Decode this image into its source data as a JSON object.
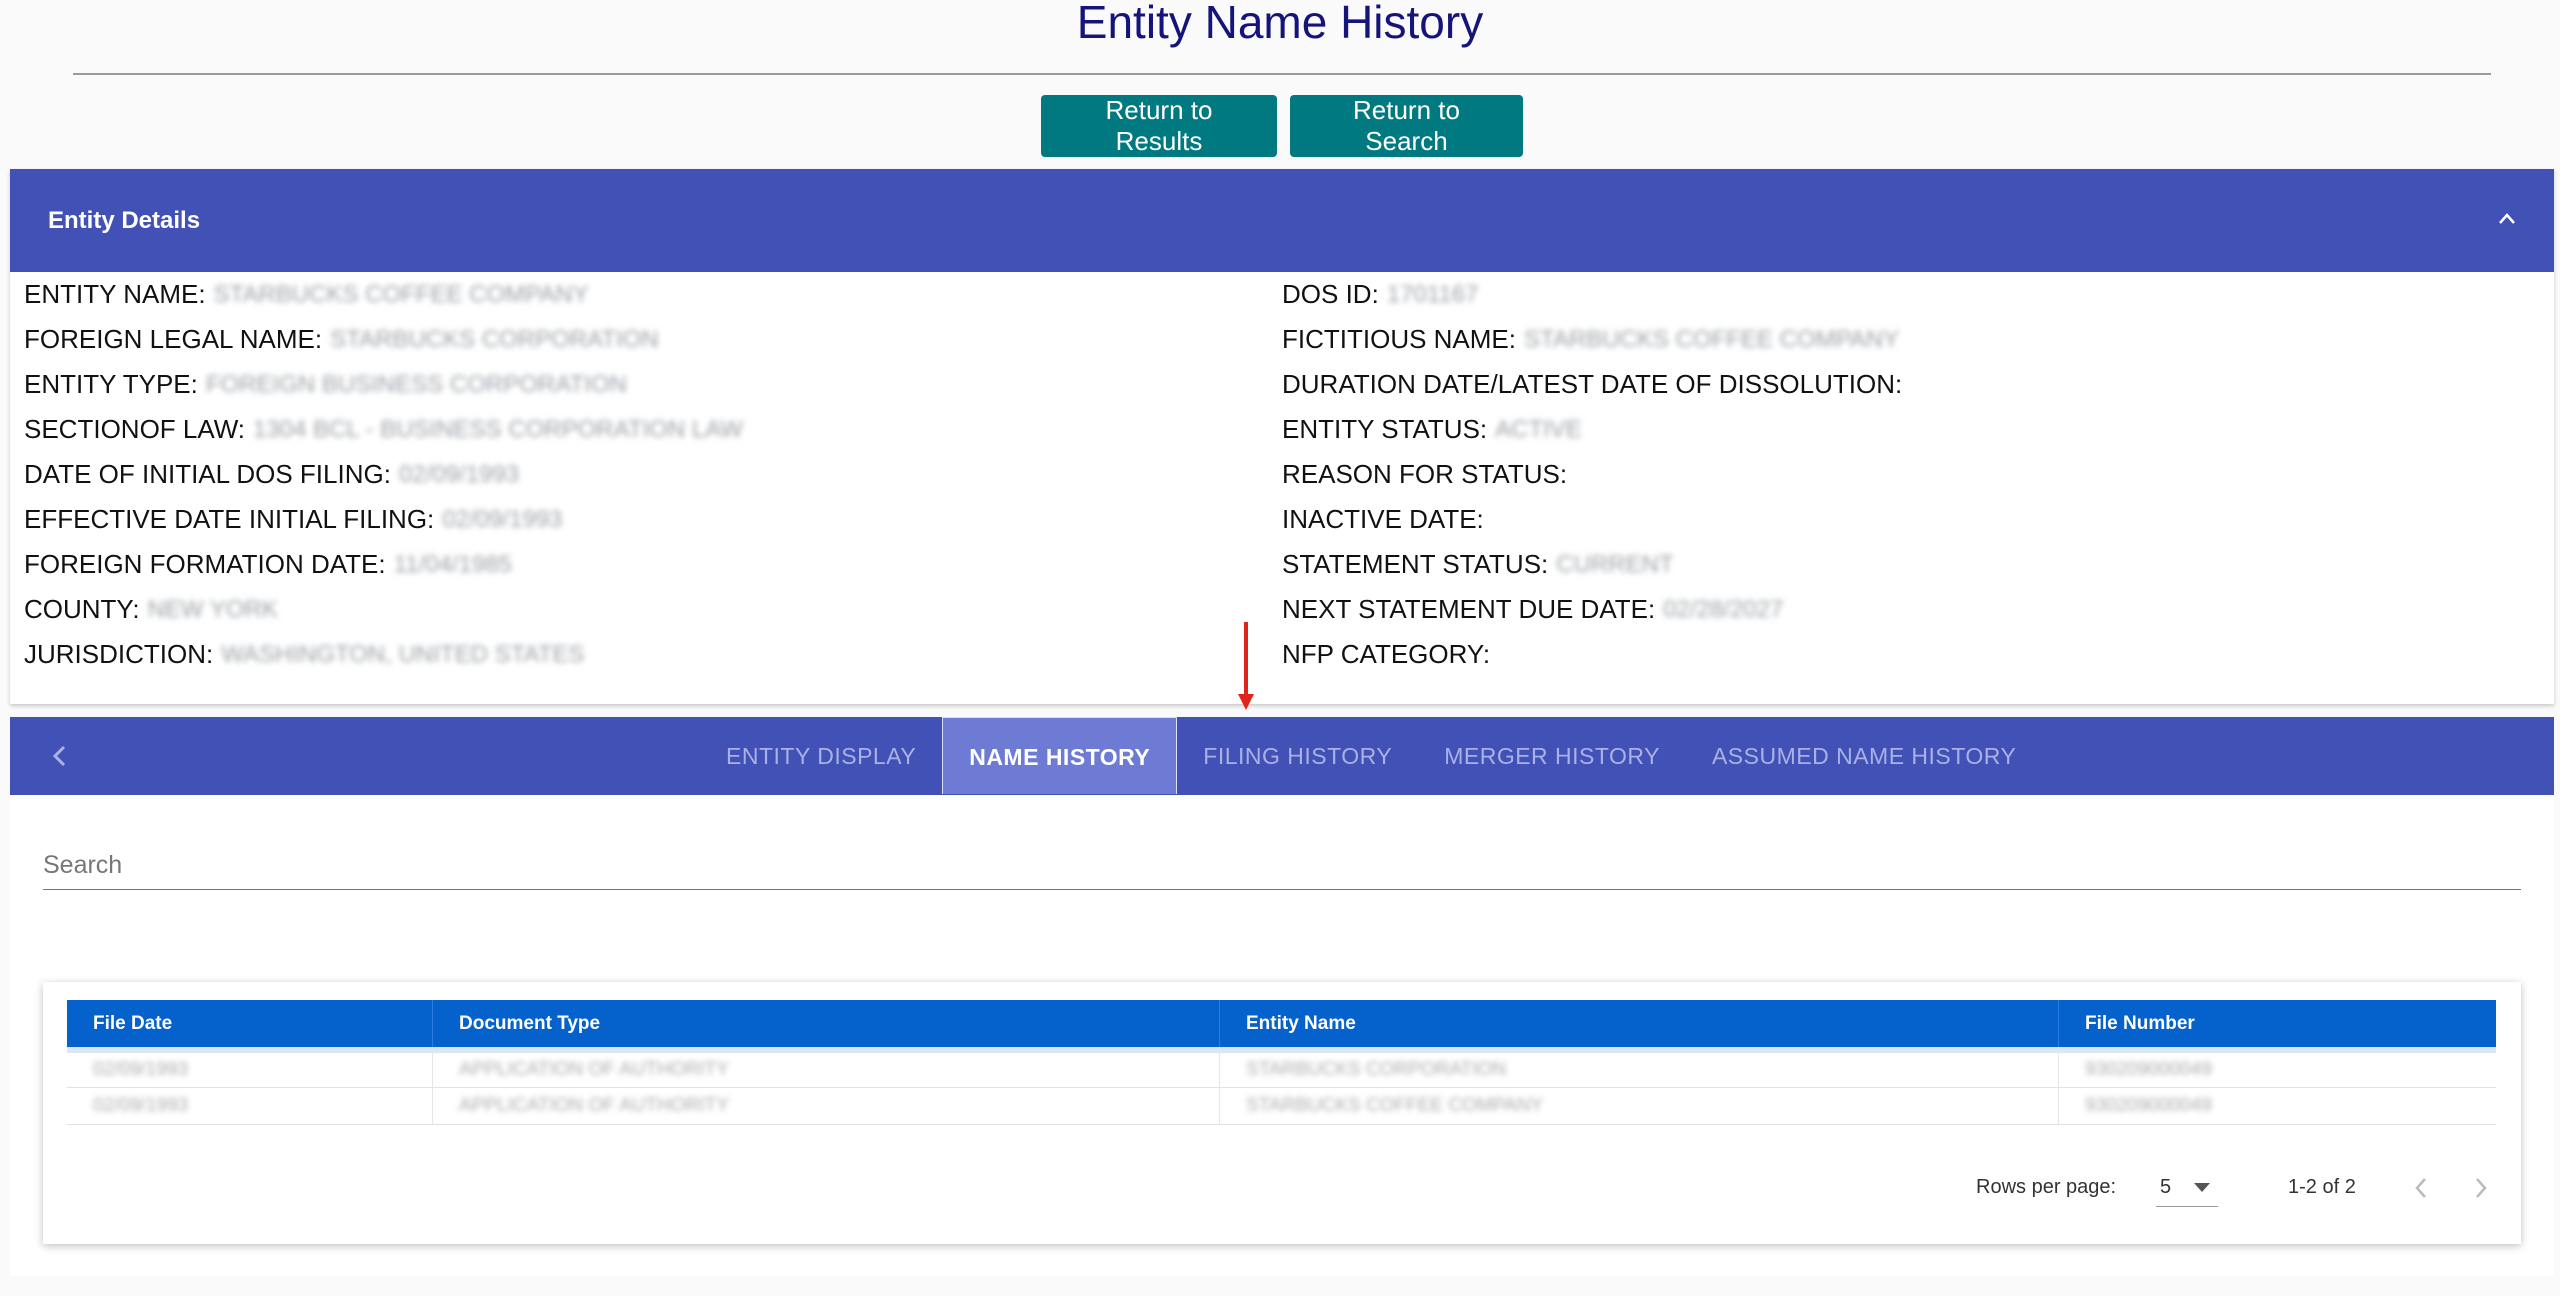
{
  "page": {
    "title": "Entity Name History"
  },
  "buttons": {
    "return_results": "Return to Results",
    "return_search": "Return to Search"
  },
  "details": {
    "header": "Entity Details",
    "left": [
      {
        "label": "ENTITY NAME:",
        "value": "STARBUCKS COFFEE COMPANY"
      },
      {
        "label": "FOREIGN LEGAL NAME:",
        "value": "STARBUCKS CORPORATION"
      },
      {
        "label": "ENTITY TYPE:",
        "value": "FOREIGN BUSINESS CORPORATION"
      },
      {
        "label": "SECTIONOF LAW:",
        "value": "1304 BCL - BUSINESS CORPORATION LAW"
      },
      {
        "label": "DATE OF INITIAL DOS FILING:",
        "value": "02/09/1993"
      },
      {
        "label": "EFFECTIVE DATE INITIAL FILING:",
        "value": "02/09/1993"
      },
      {
        "label": "FOREIGN FORMATION DATE:",
        "value": "11/04/1985"
      },
      {
        "label": "COUNTY:",
        "value": "NEW YORK"
      },
      {
        "label": "JURISDICTION:",
        "value": "WASHINGTON, UNITED STATES"
      }
    ],
    "right": [
      {
        "label": "DOS ID:",
        "value": "1701167"
      },
      {
        "label": "FICTITIOUS NAME:",
        "value": "STARBUCKS COFFEE COMPANY"
      },
      {
        "label": "DURATION DATE/LATEST DATE OF DISSOLUTION:",
        "value": ""
      },
      {
        "label": "ENTITY STATUS:",
        "value": "ACTIVE"
      },
      {
        "label": "REASON FOR STATUS:",
        "value": ""
      },
      {
        "label": "INACTIVE DATE:",
        "value": ""
      },
      {
        "label": "STATEMENT STATUS:",
        "value": "CURRENT"
      },
      {
        "label": "NEXT STATEMENT DUE DATE:",
        "value": "02/28/2027"
      },
      {
        "label": "NFP CATEGORY:",
        "value": ""
      }
    ]
  },
  "tabs": [
    {
      "label": "ENTITY DISPLAY",
      "active": false
    },
    {
      "label": "NAME HISTORY",
      "active": true
    },
    {
      "label": "FILING HISTORY",
      "active": false
    },
    {
      "label": "MERGER HISTORY",
      "active": false
    },
    {
      "label": "ASSUMED NAME HISTORY",
      "active": false
    }
  ],
  "search": {
    "placeholder": "Search"
  },
  "table": {
    "columns": [
      "File Date",
      "Document Type",
      "Entity Name",
      "File Number"
    ],
    "rows": [
      [
        "02/09/1993",
        "APPLICATION OF AUTHORITY",
        "STARBUCKS CORPORATION",
        "930209000049"
      ],
      [
        "02/09/1993",
        "APPLICATION OF AUTHORITY",
        "STARBUCKS COFFEE COMPANY",
        "930209000049"
      ]
    ]
  },
  "pagination": {
    "rows_label": "Rows per page:",
    "rows_value": "5",
    "range": "1-2 of 2"
  },
  "colors": {
    "header_blue": "#4251b5",
    "table_header": "#0561cc",
    "teal_button": "#007a80",
    "title_navy": "#14147a",
    "arrow_red": "#e0231b"
  },
  "icons": {
    "collapse": "chevron-up-icon",
    "tab_prev": "chevron-left-icon",
    "rows_dropdown": "caret-down-icon",
    "page_prev": "chevron-left-icon",
    "page_next": "chevron-right-icon",
    "annotation": "red-arrow-icon"
  }
}
